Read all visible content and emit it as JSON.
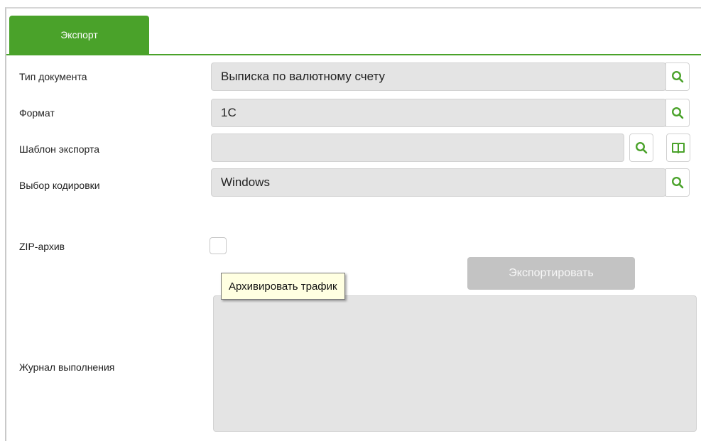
{
  "tabs": [
    {
      "label": "Экспорт",
      "active": true
    }
  ],
  "fields": {
    "doc_type": {
      "label": "Тип документа",
      "value": "Выписка по валютному счету"
    },
    "format": {
      "label": "Формат",
      "value": "1С"
    },
    "template": {
      "label": "Шаблон экспорта",
      "value": ""
    },
    "encoding": {
      "label": "Выбор кодировки",
      "value": "Windows"
    }
  },
  "zip": {
    "label": "ZIP-архив",
    "checked": false,
    "tooltip": "Архивировать трафик"
  },
  "export_button": {
    "label": "Экспортировать",
    "enabled": false
  },
  "log": {
    "label": "Журнал выполнения",
    "value": ""
  },
  "icons": {
    "search": "search-icon",
    "book": "book-icon"
  },
  "colors": {
    "accent": "#4aa22a",
    "field_bg": "#e4e4e4",
    "disabled_button": "#c3c3c3",
    "tooltip_bg": "#ffffe1"
  }
}
